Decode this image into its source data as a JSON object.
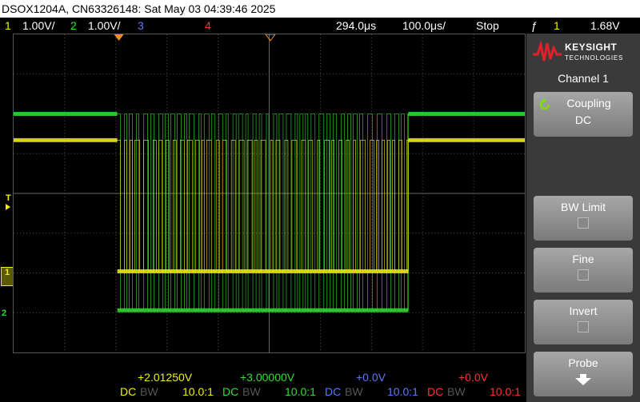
{
  "title": "DSOX1204A, CN63326148: Sat May 03 04:39:46 2025",
  "channels_top": [
    {
      "num": "1",
      "scale": "1.00V/",
      "color": "#f0f000"
    },
    {
      "num": "2",
      "scale": "1.00V/",
      "color": "#32dc32"
    },
    {
      "num": "3",
      "scale": "",
      "color": "#5a78ff"
    },
    {
      "num": "4",
      "scale": "",
      "color": "#ff3030"
    }
  ],
  "timebase": {
    "delay": "294.0μs",
    "scale": "100.0μs/",
    "run_state": "Stop"
  },
  "trigger": {
    "icon": "trigger-edge-icon",
    "glyph": "ƒ",
    "channel": "1",
    "level": "1.68V"
  },
  "markers": {
    "trigger": "T",
    "ch1": "1",
    "ch2": "2"
  },
  "brand": {
    "name": "KEYSIGHT",
    "sub": "TECHNOLOGIES"
  },
  "panel": {
    "title": "Channel 1",
    "softkeys": [
      {
        "label": "Coupling",
        "value": "DC",
        "icon": "refresh-icon"
      },
      {
        "label": "BW Limit",
        "value": ""
      },
      {
        "label": "Fine",
        "value": ""
      },
      {
        "label": "Invert",
        "value": ""
      },
      {
        "label": "Probe",
        "value": "",
        "icon": "arrow-down-icon"
      }
    ]
  },
  "bottom": [
    {
      "offset": "+2.01250V",
      "coupling": "DC",
      "bw": "BW",
      "probe": "10.0:1",
      "color": "#f0f000"
    },
    {
      "offset": "+3.00000V",
      "coupling": "DC",
      "bw": "BW",
      "probe": "10.0:1",
      "color": "#32dc32"
    },
    {
      "offset": "+0.0V",
      "coupling": "DC",
      "bw": "BW",
      "probe": "10.0:1",
      "color": "#5a78ff"
    },
    {
      "offset": "+0.0V",
      "coupling": "DC",
      "bw": "BW",
      "probe": "10.0:1",
      "color": "#ff3030"
    }
  ]
}
